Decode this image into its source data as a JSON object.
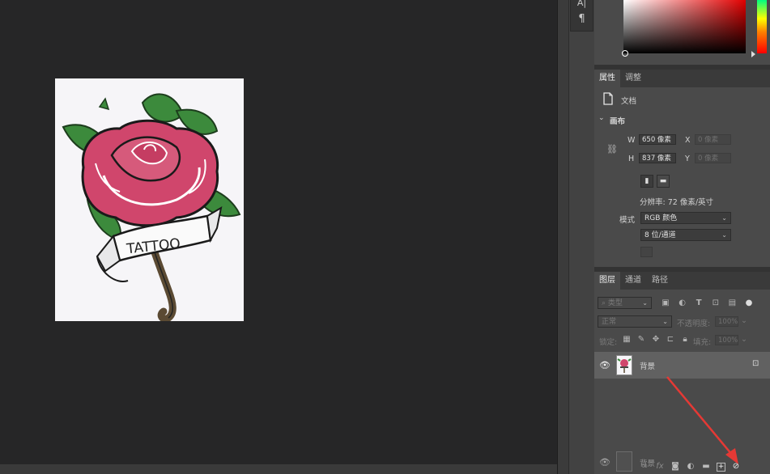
{
  "canvas": {
    "tattoo_text": "TATTOO"
  },
  "tools": {
    "glyph_1": "A|",
    "glyph_2": "¶"
  },
  "properties_panel": {
    "tabs": [
      "属性",
      "调整"
    ],
    "doc_label": "文档",
    "canvas_section": "画布",
    "width_label": "W",
    "width_value": "650 像素",
    "height_label": "H",
    "height_value": "837 像素",
    "x_label": "X",
    "x_placeholder": "0 像素",
    "y_label": "Y",
    "y_placeholder": "0 像素",
    "resolution": "分辨率: 72 像素/英寸",
    "mode_label": "模式",
    "mode_value": "RGB 颜色",
    "depth_value": "8 位/通道"
  },
  "layers_panel": {
    "tabs": [
      "图层",
      "通道",
      "路径"
    ],
    "search_placeholder": "类型",
    "blend_mode": "正常",
    "opacity_label": "不透明度:",
    "opacity_value": "100%",
    "lock_label": "锁定:",
    "fill_label": "填充:",
    "fill_value": "100%",
    "layers": [
      {
        "name": "背景"
      }
    ],
    "ghost_layer_name": "背景"
  },
  "colors": {
    "accent_red": "#e53935",
    "panel_bg": "#4a4a4a",
    "canvas_bg": "#262627"
  }
}
